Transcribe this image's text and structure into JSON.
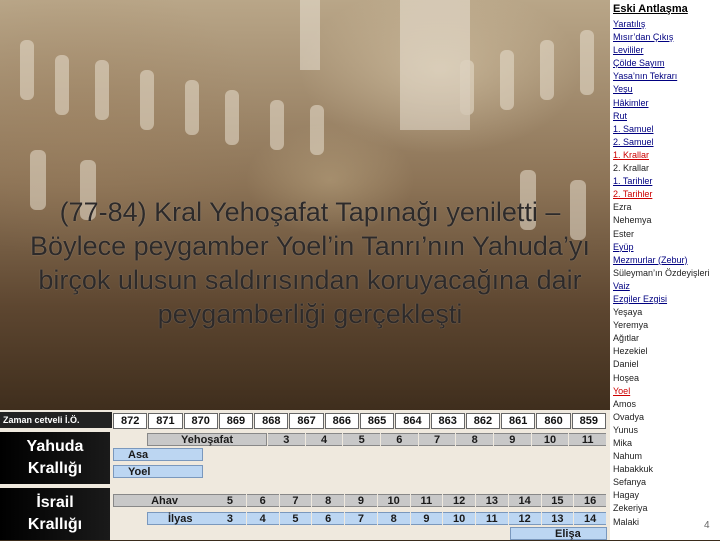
{
  "slide": {
    "text": "(77-84) Kral Yehoşafat Tapınağı yeniletti – Böylece peygamber Yoel’in Tanrı’nın Yahuda’yı birçok ulusun saldırısından koruyacağına dair peygamberliği gerçekleşti"
  },
  "timeline": {
    "header_label": "Zaman cetveli İ.Ö.",
    "years": [
      "872",
      "871",
      "870",
      "869",
      "868",
      "867",
      "866",
      "865",
      "864",
      "863",
      "862",
      "861",
      "860",
      "859"
    ],
    "judah": {
      "label_line1": "Yahuda",
      "label_line2": "Krallığı",
      "king1_name": "Yehoşafat",
      "king1_years": [
        "3",
        "4",
        "5",
        "6",
        "7",
        "8",
        "9",
        "10",
        "11"
      ],
      "king2_name": "Asa",
      "king3_name": "Yoel"
    },
    "israel": {
      "label_line1": "İsrail",
      "label_line2": "Krallığı",
      "king1_name": "Ahav",
      "king1_years": [
        "5",
        "6",
        "7",
        "8",
        "9",
        "10",
        "11",
        "12",
        "13",
        "14",
        "15",
        "16"
      ],
      "king2_name": "İlyas",
      "king2_years": [
        "3",
        "4",
        "5",
        "6",
        "7",
        "8",
        "9",
        "10",
        "11",
        "12",
        "13",
        "14"
      ],
      "king3_name": "Elişa"
    },
    "colors": {
      "gray_bar": "#c8c8c8",
      "blue_bar": "#bcd6f2"
    }
  },
  "sidebar": {
    "title": "Eski Antlaşma",
    "books": [
      {
        "label": "Yaratılış",
        "style": "link"
      },
      {
        "label": "Mısır’dan Çıkış",
        "style": "link"
      },
      {
        "label": "Levililer",
        "style": "link"
      },
      {
        "label": "Çölde Sayım",
        "style": "link"
      },
      {
        "label": "Yasa’nın Tekrarı",
        "style": "link"
      },
      {
        "label": "Yeşu",
        "style": "link"
      },
      {
        "label": "Hâkimler",
        "style": "link"
      },
      {
        "label": "Rut",
        "style": "link"
      },
      {
        "label": "1. Samuel",
        "style": "link"
      },
      {
        "label": "2. Samuel",
        "style": "link"
      },
      {
        "label": "1. Krallar",
        "style": "active"
      },
      {
        "label": "2. Krallar",
        "style": "plain"
      },
      {
        "label": "1. Tarihler",
        "style": "link"
      },
      {
        "label": "2. Tarihler",
        "style": "active"
      },
      {
        "label": "Ezra",
        "style": "plain"
      },
      {
        "label": "Nehemya",
        "style": "plain"
      },
      {
        "label": "Ester",
        "style": "plain"
      },
      {
        "label": "Eyüp",
        "style": "link"
      },
      {
        "label": "Mezmurlar (Zebur)",
        "style": "link"
      },
      {
        "label": "Süleyman’ın Özdeyişleri",
        "style": "plain"
      },
      {
        "label": "Vaiz",
        "style": "link"
      },
      {
        "label": "Ezgiler Ezgisi",
        "style": "link"
      },
      {
        "label": "Yeşaya",
        "style": "plain"
      },
      {
        "label": "Yeremya",
        "style": "plain"
      },
      {
        "label": "Ağıtlar",
        "style": "plain"
      },
      {
        "label": "Hezekiel",
        "style": "plain"
      },
      {
        "label": "Daniel",
        "style": "plain"
      },
      {
        "label": "Hoşea",
        "style": "plain"
      },
      {
        "label": "Yoel",
        "style": "active"
      },
      {
        "label": "Amos",
        "style": "plain"
      },
      {
        "label": "Ovadya",
        "style": "plain"
      },
      {
        "label": "Yunus",
        "style": "plain"
      },
      {
        "label": "Mika",
        "style": "plain"
      },
      {
        "label": "Nahum",
        "style": "plain"
      },
      {
        "label": "Habakkuk",
        "style": "plain"
      },
      {
        "label": "Sefanya",
        "style": "plain"
      },
      {
        "label": "Hagay",
        "style": "plain"
      },
      {
        "label": "Zekeriya",
        "style": "plain"
      },
      {
        "label": "Malaki",
        "style": "plain"
      }
    ],
    "page_number": "4"
  }
}
